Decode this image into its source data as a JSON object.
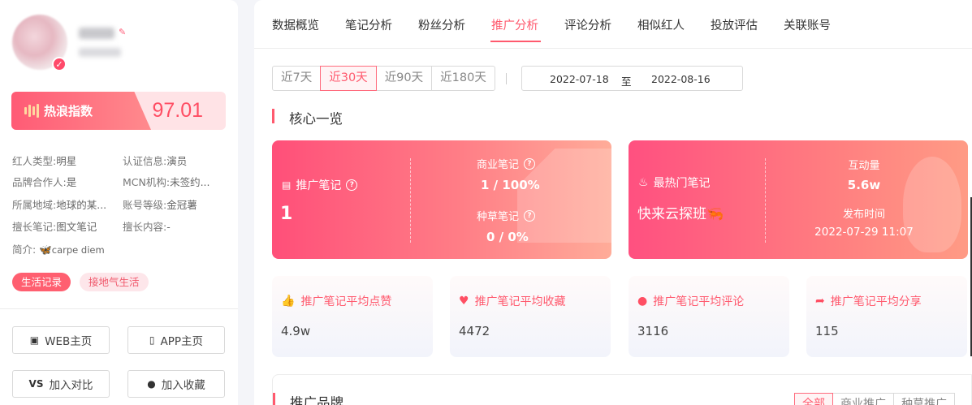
{
  "profile": {
    "heat_label": "热浪指数",
    "heat_value": "97.01",
    "info": [
      {
        "k": "红人类型:",
        "v": "明星"
      },
      {
        "k": "认证信息:",
        "v": "演员"
      },
      {
        "k": "品牌合作人:",
        "v": "是"
      },
      {
        "k": "MCN机构:",
        "v": "未签约..."
      },
      {
        "k": "所属地域:",
        "v": "地球的某..."
      },
      {
        "k": "账号等级:",
        "v": "金冠薯"
      },
      {
        "k": "擅长笔记:",
        "v": "图文笔记"
      },
      {
        "k": "擅长内容:",
        "v": "-"
      }
    ],
    "bio_label": "简介:",
    "bio_text": "carpe diem",
    "tags": [
      "生活记录",
      "接地气生活"
    ],
    "buttons": {
      "web": "WEB主页",
      "app": "APP主页",
      "compare": "加入对比",
      "favorite": "加入收藏"
    }
  },
  "tabs": [
    "数据概览",
    "笔记分析",
    "粉丝分析",
    "推广分析",
    "评论分析",
    "相似红人",
    "投放评估",
    "关联账号"
  ],
  "active_tab": "推广分析",
  "ranges": [
    "近7天",
    "近30天",
    "近90天",
    "近180天"
  ],
  "active_range": "近30天",
  "dates": {
    "start": "2022-07-18",
    "sep": "至",
    "end": "2022-08-16"
  },
  "overview": {
    "title": "核心一览",
    "promo_label": "推广笔记",
    "promo_value": "1",
    "commercial_label": "商业笔记",
    "commercial_value": "1 / 100%",
    "seeding_label": "种草笔记",
    "seeding_value": "0 / 0%",
    "hot_label": "最热门笔记",
    "hot_title": "快来云探班🦐",
    "interaction_label": "互动量",
    "interaction_value": "5.6w",
    "publish_label": "发布时间",
    "publish_value": "2022-07-29 11:07"
  },
  "stats": [
    {
      "label": "推广笔记平均点赞",
      "value": "4.9w",
      "icon": "thumbs-up-icon"
    },
    {
      "label": "推广笔记平均收藏",
      "value": "4472",
      "icon": "heart-icon"
    },
    {
      "label": "推广笔记平均评论",
      "value": "3116",
      "icon": "comment-icon"
    },
    {
      "label": "推广笔记平均分享",
      "value": "115",
      "icon": "share-icon"
    }
  ],
  "brands": {
    "title": "推广品牌",
    "filters": [
      "全部",
      "商业推广",
      "种草推广"
    ]
  },
  "colors": {
    "accent": "#ff5a6e"
  }
}
